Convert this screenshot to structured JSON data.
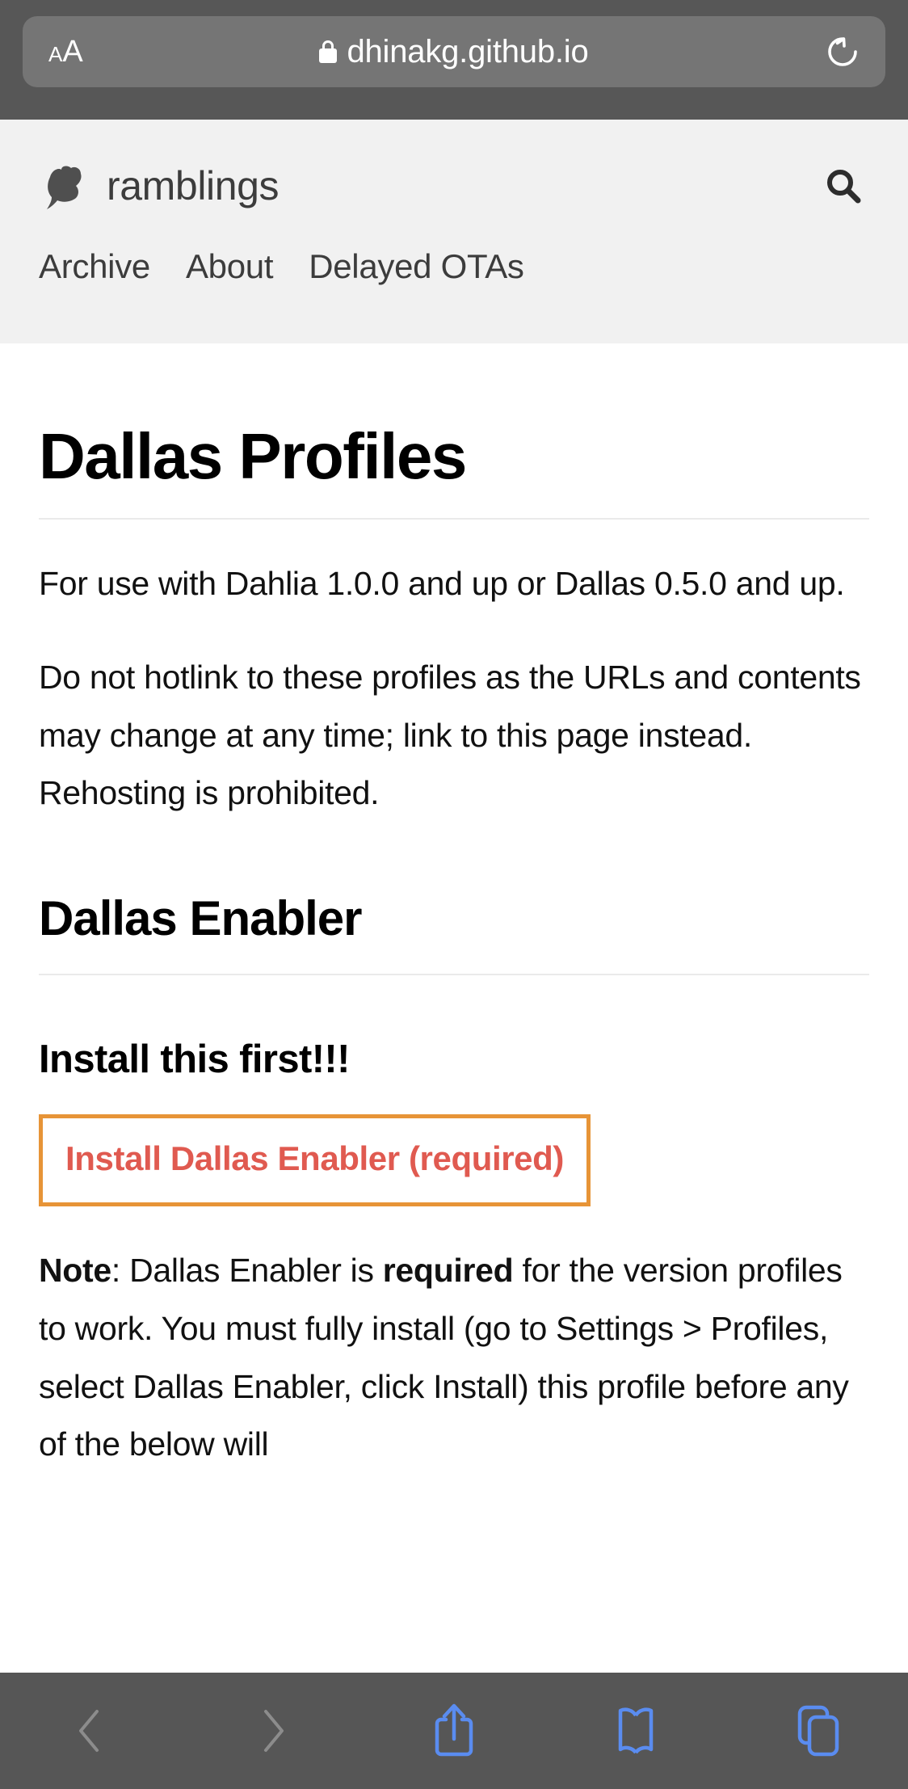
{
  "browser": {
    "text_size_button": {
      "small": "A",
      "large": "A"
    },
    "url": "dhinakg.github.io",
    "lock_icon": "lock-icon",
    "reload_icon": "reload-icon",
    "secure": true
  },
  "site": {
    "logo_icon": "ginkgo-leaf-logo",
    "title": "ramblings",
    "search_icon": "search-icon",
    "nav": [
      {
        "label": "Archive"
      },
      {
        "label": "About"
      },
      {
        "label": "Delayed OTAs"
      }
    ]
  },
  "page": {
    "title": "Dallas Profiles",
    "paragraphs": [
      "For use with Dahlia 1.0.0 and up or Dallas 0.5.0 and up.",
      "Do not hotlink to these profiles as the URLs and contents may change at any time; link to this page instead. Rehosting is prohibited."
    ],
    "section_title": "Dallas Enabler",
    "sub_title": "Install this first!!!",
    "callout_link": "Install Dallas Enabler (required)",
    "note": {
      "label": "Note",
      "separator": ": ",
      "part1": "Dallas Enabler is ",
      "emphasis": "required",
      "part2": " for the version profiles to work. You must fully install (go to Settings > Profiles, select Dallas Enabler, click Install) this profile before any of the below will"
    }
  },
  "toolbar": {
    "back_icon": "chevron-left-icon",
    "forward_icon": "chevron-right-icon",
    "share_icon": "share-icon",
    "bookmarks_icon": "book-icon",
    "tabs_icon": "tabs-icon"
  },
  "colors": {
    "chrome_bg": "#575757",
    "url_bar_bg": "#757575",
    "header_bg": "#f1f1f1",
    "callout_border": "#e79437",
    "callout_link": "#e05a50",
    "toolbar_bg": "#565656",
    "toolbar_icon": "#5a8cf0",
    "toolbar_icon_disabled": "#8c8c8c"
  }
}
